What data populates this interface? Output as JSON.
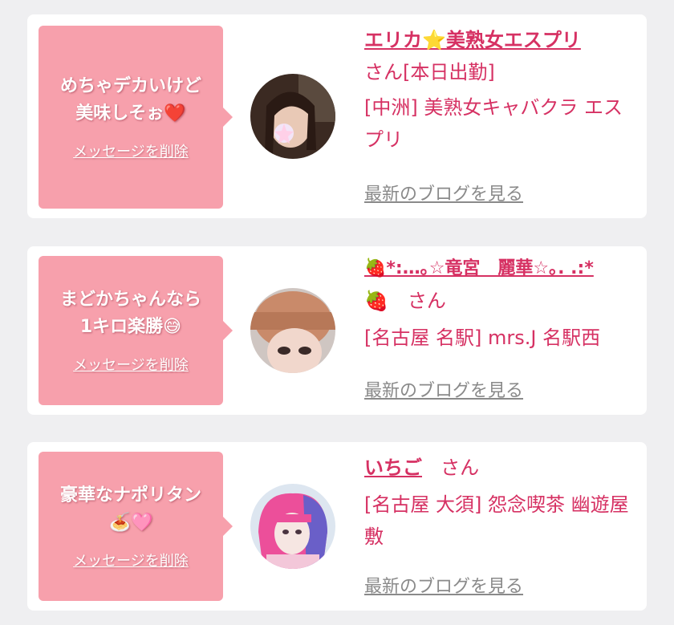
{
  "cards": [
    {
      "message": "めちゃデカいけど\n美味しそぉ❤️",
      "delete_label": "メッセージを削除",
      "name": "エリカ⭐美熟女エスプリ",
      "suffix": "さん[本日出勤]",
      "shop": "[中洲] 美熟女キャバクラ エスプリ",
      "blog_label": "最新のブログを見る"
    },
    {
      "message": "まどかちゃんなら\n1キロ楽勝😅",
      "delete_label": "メッセージを削除",
      "name": "🍓*:…｡☆竜宮　麗華☆｡. .:*",
      "suffix": "🍓　さん",
      "shop": "[名古屋 名駅] mrs.J 名駅西",
      "blog_label": "最新のブログを見る"
    },
    {
      "message": "豪華なナポリタン\n🍝🩷",
      "delete_label": "メッセージを削除",
      "name": "いちご",
      "suffix": "さん",
      "shop": "[名古屋 大須] 怨念喫茶 幽遊屋敷",
      "blog_label": "最新のブログを見る"
    }
  ],
  "colors": {
    "background": "#efeff1",
    "bubble": "#f7a0ac",
    "accent": "#d63163",
    "link_gray": "#8a8a8a"
  }
}
